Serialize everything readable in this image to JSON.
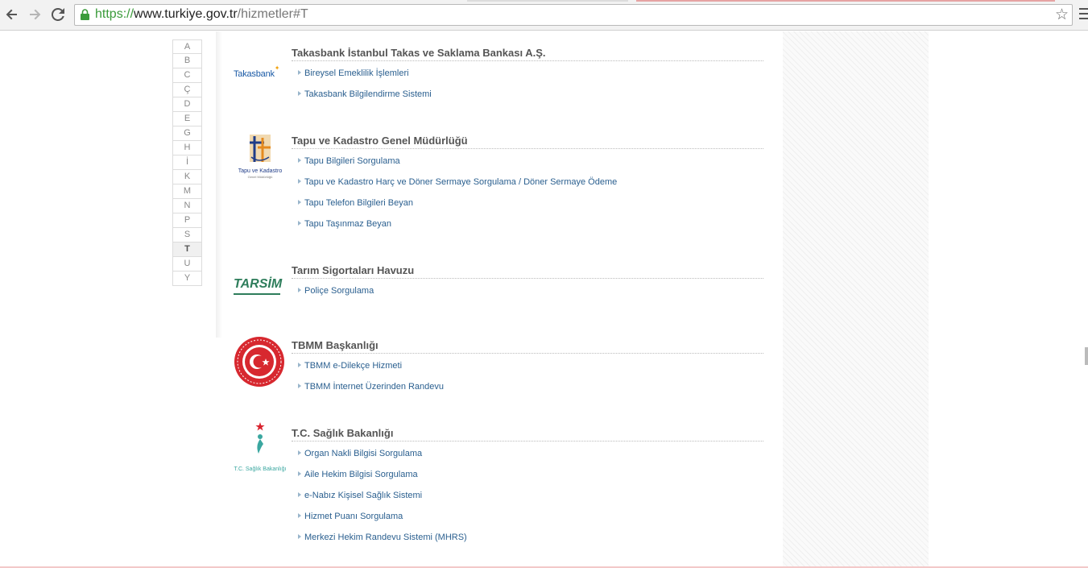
{
  "browser": {
    "url_scheme": "https://",
    "url_host": "www.turkiye.gov.tr",
    "url_path": "/hizmetler#T",
    "back_icon": "back-arrow-icon",
    "forward_icon": "forward-arrow-icon",
    "reload_icon": "reload-icon",
    "bookmark_icon": "star-icon",
    "menu_icon": "hamburger-menu-icon"
  },
  "alphabet": {
    "letters": [
      "A",
      "B",
      "C",
      "Ç",
      "D",
      "E",
      "G",
      "H",
      "İ",
      "K",
      "M",
      "N",
      "P",
      "S",
      "T",
      "U",
      "Y"
    ],
    "active": "T"
  },
  "institutions": [
    {
      "logo_text": "Takasbank",
      "title": "Takasbank İstanbul Takas ve Saklama Bankası A.Ş.",
      "services": [
        "Bireysel Emeklilik İşlemleri",
        "Takasbank Bilgilendirme Sistemi"
      ]
    },
    {
      "logo_text": "Tapu ve Kadastro",
      "logo_subtext": "Genel Müdürlüğü",
      "title": "Tapu ve Kadastro Genel Müdürlüğü",
      "services": [
        "Tapu Bilgileri Sorgulama",
        "Tapu ve Kadastro Harç ve Döner Sermaye Sorgulama / Döner Sermaye Ödeme",
        "Tapu Telefon Bilgileri Beyan",
        "Tapu Taşınmaz Beyan"
      ]
    },
    {
      "logo_text": "TARSİM",
      "title": "Tarım Sigortaları Havuzu",
      "services": [
        "Poliçe Sorgulama"
      ]
    },
    {
      "title": "TBMM Başkanlığı",
      "services": [
        "TBMM e-Dilekçe Hizmeti",
        "TBMM İnternet Üzerinden Randevu"
      ]
    },
    {
      "logo_text": "T.C. Sağlık Bakanlığı",
      "title": "T.C. Sağlık Bakanlığı",
      "services": [
        "Organ Nakli Bilgisi Sorgulama",
        "Aile Hekim Bilgisi Sorgulama",
        "e-Nabız Kişisel Sağlık Sistemi",
        "Hizmet Puanı Sorgulama",
        "Merkezi Hekim Randevu Sistemi (MHRS)"
      ]
    }
  ],
  "colors": {
    "link": "#2a5f8f",
    "title": "#555555",
    "takasbank_blue": "#1a5aa6",
    "tarsim_green": "#2e7d5b",
    "tbmm_red": "#d7282f",
    "saglik_red": "#d9232e"
  }
}
